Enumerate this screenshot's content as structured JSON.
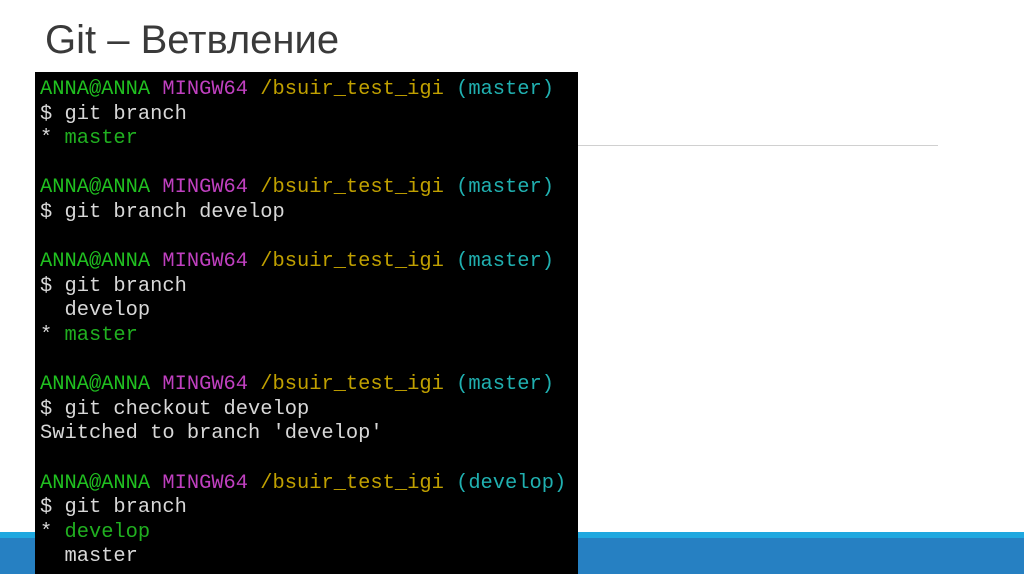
{
  "slide": {
    "title": "Git – Ветвление"
  },
  "colors": {
    "user": "#20c020",
    "mingw": "#c040c0",
    "path": "#c0a000",
    "branch": "#20b0b0",
    "text": "#d8d8d8",
    "current": "#20b020",
    "accent_light": "#1fa8e0",
    "accent_dark": "#2680c2"
  },
  "terminal": {
    "lines": [
      [
        {
          "t": "ANNA@ANNA ",
          "c": "user"
        },
        {
          "t": "MINGW64 ",
          "c": "mingw"
        },
        {
          "t": "/bsuir_test_igi ",
          "c": "path"
        },
        {
          "t": "(master)",
          "c": "branch"
        }
      ],
      [
        {
          "t": "$ git branch",
          "c": "text"
        }
      ],
      [
        {
          "t": "* ",
          "c": "text"
        },
        {
          "t": "master",
          "c": "current"
        }
      ],
      [],
      [
        {
          "t": "ANNA@ANNA ",
          "c": "user"
        },
        {
          "t": "MINGW64 ",
          "c": "mingw"
        },
        {
          "t": "/bsuir_test_igi ",
          "c": "path"
        },
        {
          "t": "(master)",
          "c": "branch"
        }
      ],
      [
        {
          "t": "$ git branch develop",
          "c": "text"
        }
      ],
      [],
      [
        {
          "t": "ANNA@ANNA ",
          "c": "user"
        },
        {
          "t": "MINGW64 ",
          "c": "mingw"
        },
        {
          "t": "/bsuir_test_igi ",
          "c": "path"
        },
        {
          "t": "(master)",
          "c": "branch"
        }
      ],
      [
        {
          "t": "$ git branch",
          "c": "text"
        }
      ],
      [
        {
          "t": "  develop",
          "c": "text"
        }
      ],
      [
        {
          "t": "* ",
          "c": "text"
        },
        {
          "t": "master",
          "c": "current"
        }
      ],
      [],
      [
        {
          "t": "ANNA@ANNA ",
          "c": "user"
        },
        {
          "t": "MINGW64 ",
          "c": "mingw"
        },
        {
          "t": "/bsuir_test_igi ",
          "c": "path"
        },
        {
          "t": "(master)",
          "c": "branch"
        }
      ],
      [
        {
          "t": "$ git checkout develop",
          "c": "text"
        }
      ],
      [
        {
          "t": "Switched to branch 'develop'",
          "c": "text"
        }
      ],
      [],
      [
        {
          "t": "ANNA@ANNA ",
          "c": "user"
        },
        {
          "t": "MINGW64 ",
          "c": "mingw"
        },
        {
          "t": "/bsuir_test_igi ",
          "c": "path"
        },
        {
          "t": "(develop)",
          "c": "branch"
        }
      ],
      [
        {
          "t": "$ git branch",
          "c": "text"
        }
      ],
      [
        {
          "t": "* ",
          "c": "text"
        },
        {
          "t": "develop",
          "c": "current"
        }
      ],
      [
        {
          "t": "  master",
          "c": "text"
        }
      ]
    ]
  }
}
